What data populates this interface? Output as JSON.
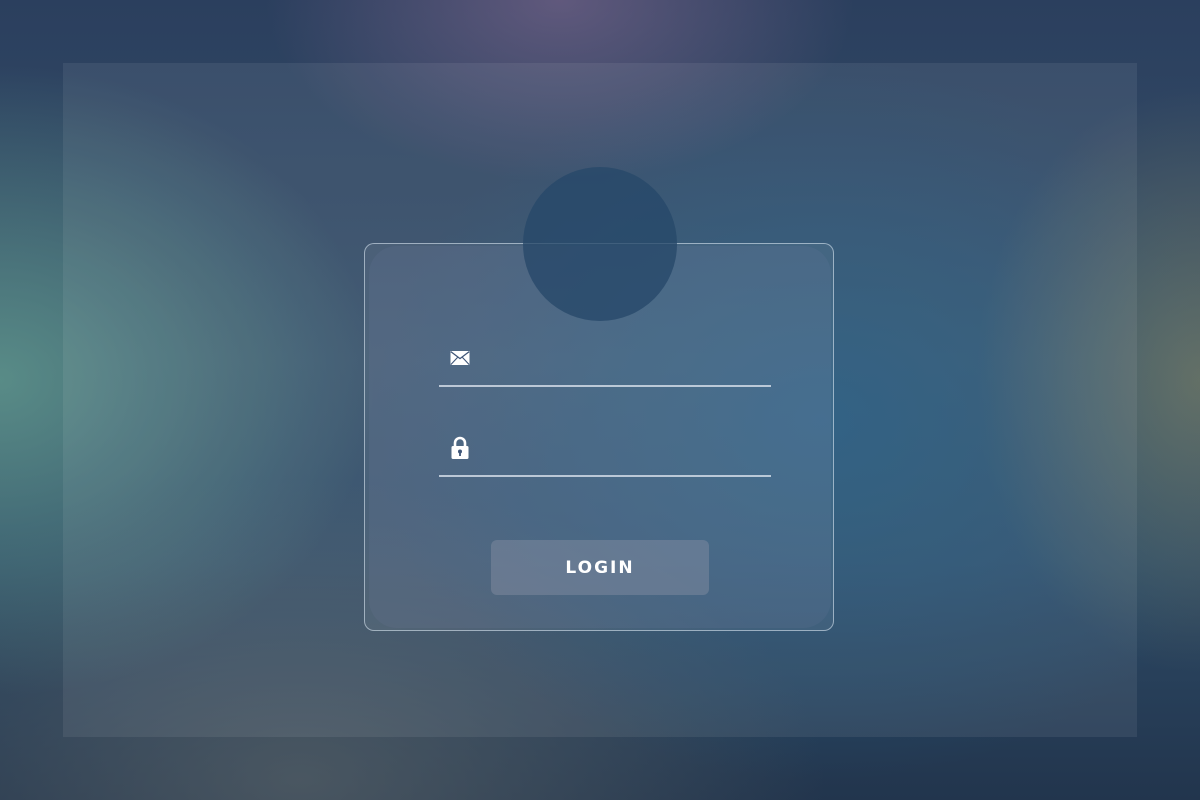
{
  "login_form": {
    "email": {
      "icon": "envelope-icon",
      "value": "",
      "placeholder": ""
    },
    "password": {
      "icon": "lock-icon",
      "value": "",
      "placeholder": ""
    },
    "submit_label": "LOGIN"
  },
  "colors": {
    "text": "#ffffff",
    "underline": "#e1e8f2",
    "button_bg": "#6a7590",
    "avatar_bg": "#264869"
  }
}
